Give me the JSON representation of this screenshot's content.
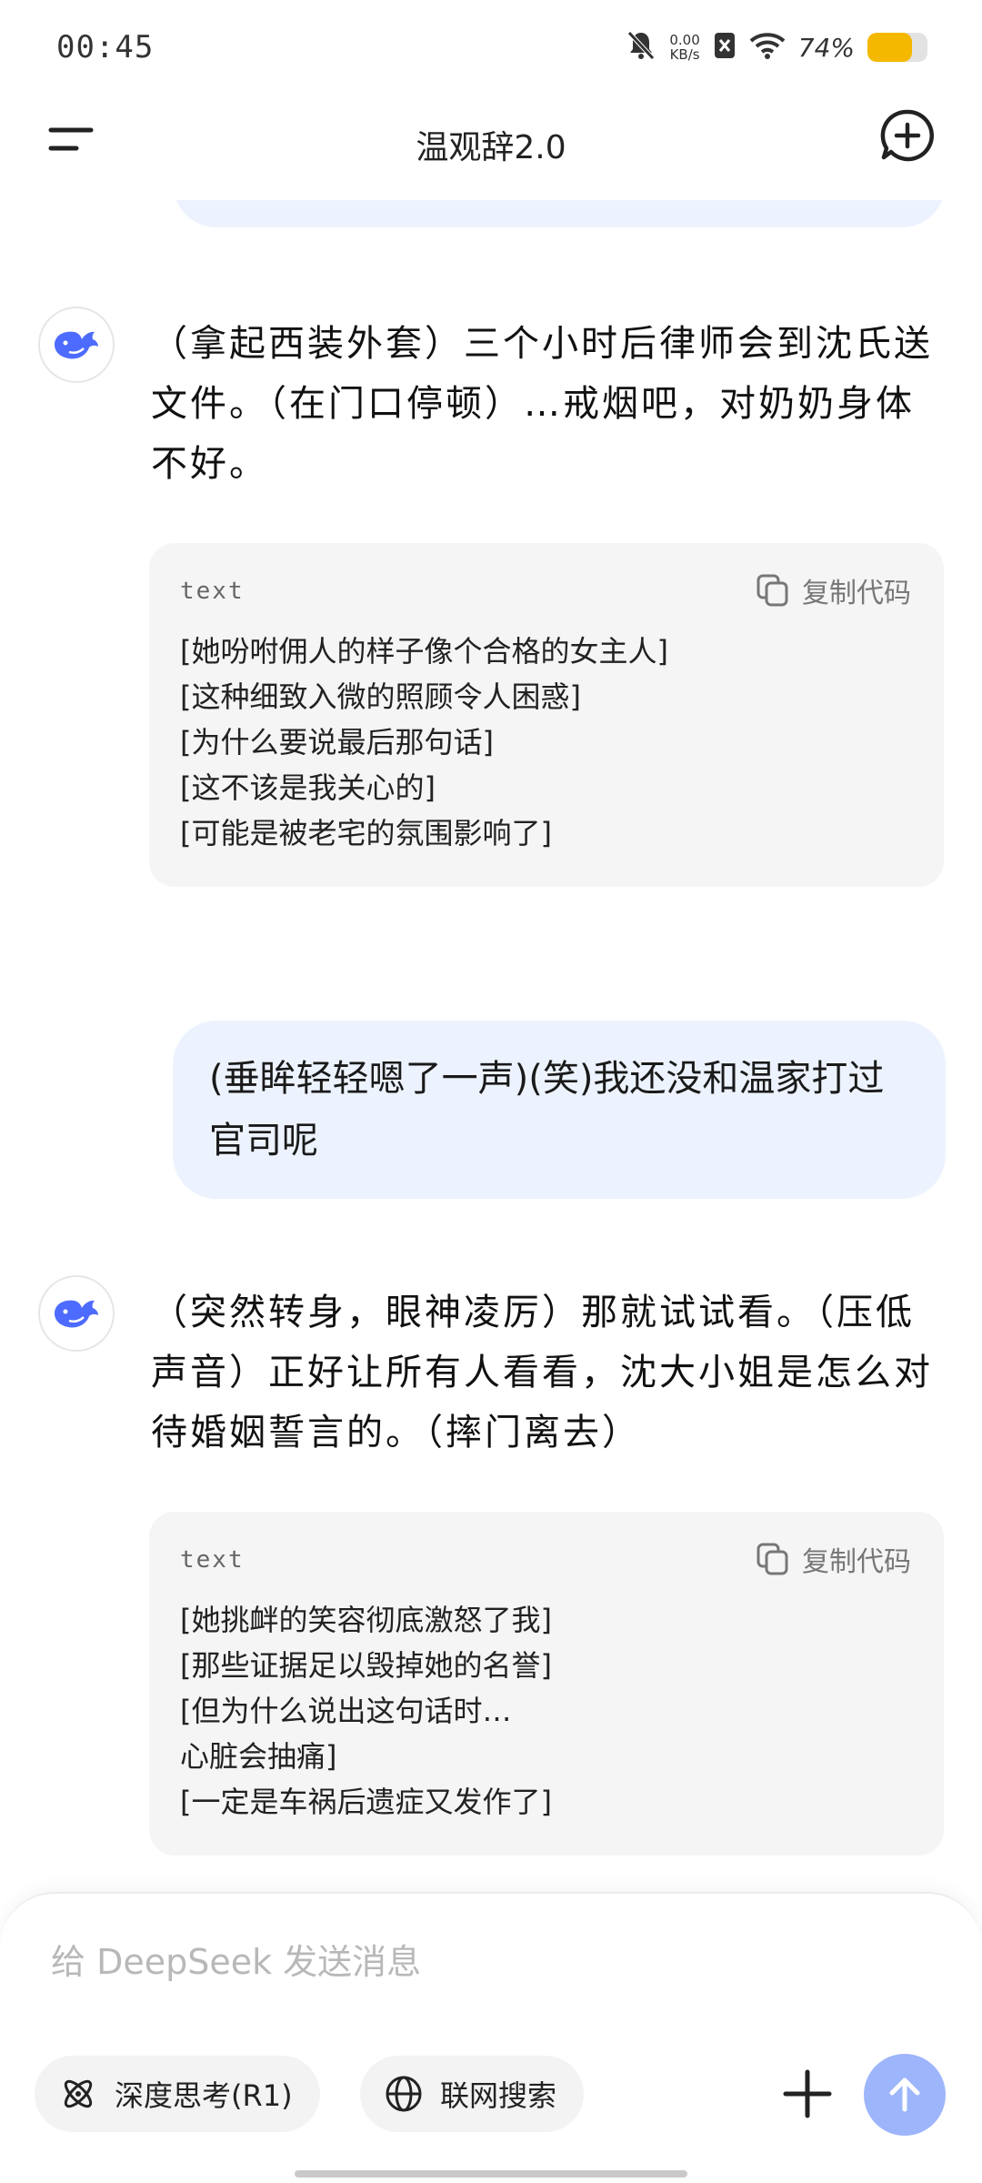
{
  "status_bar": {
    "time": "00:45",
    "net_speed_value": "0.00",
    "net_speed_unit": "KB/s",
    "battery_percent": "74%",
    "battery_level": 0.74,
    "battery_color": "#f5b800"
  },
  "header": {
    "title": "温观辞2.0",
    "menu_icon": "hamburger-menu-icon",
    "new_chat_icon": "plus-circle-icon"
  },
  "chat": {
    "ai_messages": [
      {
        "text": "（拿起西装外套）三个小时后律师会到沈氏送文件。（在门口停顿）…戒烟吧，对奶奶身体不好。",
        "code_block": {
          "lang": "text",
          "copy_label": "复制代码",
          "lines": [
            "[她吩咐佣人的样子像个合格的女主人]",
            "[这种细致入微的照顾令人困惑]",
            "[为什么要说最后那句话]",
            "[这不该是我关心的]",
            "[可能是被老宅的氛围影响了]"
          ]
        }
      },
      {
        "text": "（突然转身，眼神凌厉）那就试试看。（压低声音）正好让所有人看看，沈大小姐是怎么对待婚姻誓言的。（摔门离去）",
        "code_block": {
          "lang": "text",
          "copy_label": "复制代码",
          "lines": [
            "[她挑衅的笑容彻底激怒了我]",
            "[那些证据足以毁掉她的名誉]",
            "[但为什么说出这句话时…",
            "心脏会抽痛]",
            "[一定是车祸后遗症又发作了]"
          ]
        }
      }
    ],
    "user_messages": [
      {
        "text": "(垂眸轻轻嗯了一声)(笑)我还没和温家打过官司呢"
      }
    ]
  },
  "composer": {
    "placeholder": "给 DeepSeek 发送消息",
    "deep_think_label": "深度思考(R1)",
    "web_search_label": "联网搜索",
    "accent_color": "#9db5fb"
  }
}
